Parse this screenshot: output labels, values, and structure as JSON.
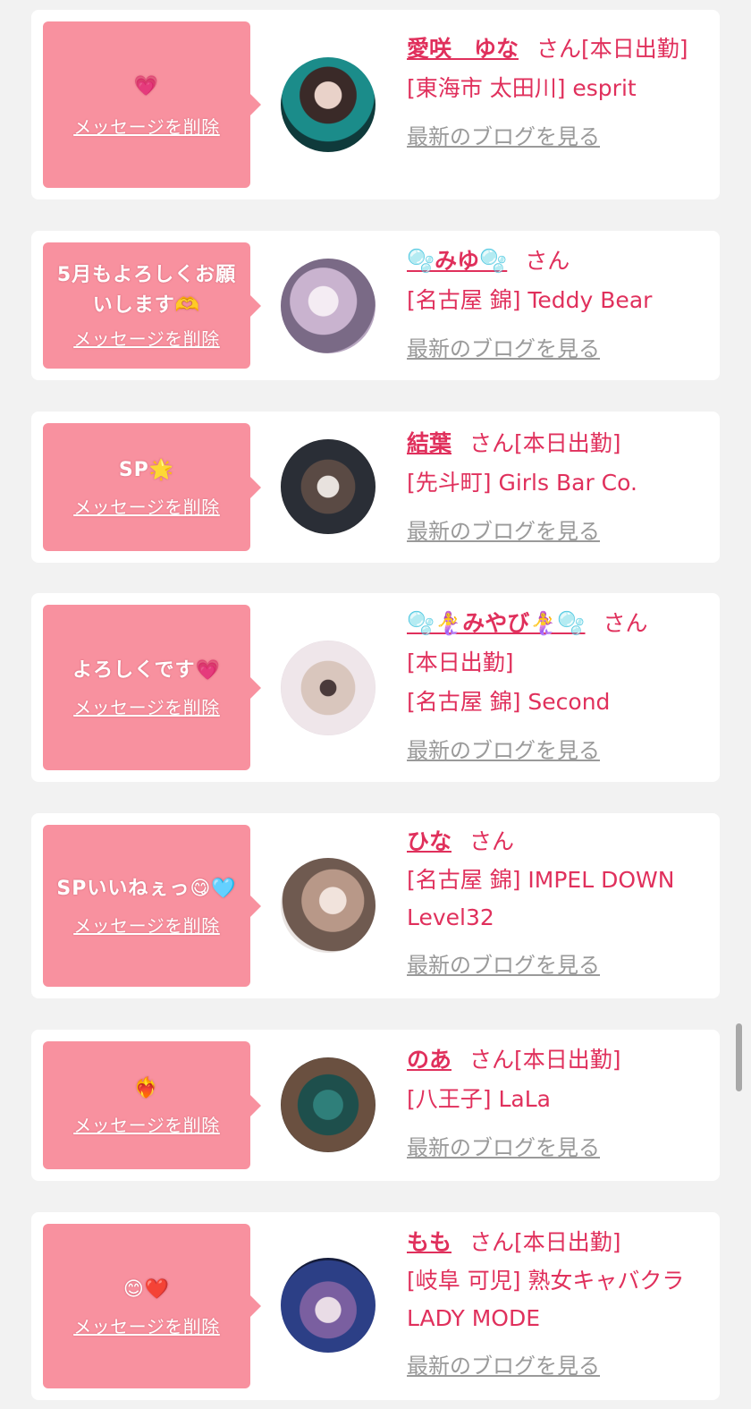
{
  "accent_color": "#e0305c",
  "bubble_color": "#f8919f",
  "link_gray": "#9a9a9a",
  "cards": [
    {
      "message": "💗",
      "delete_label": "メッセージを削除",
      "name": "愛咲　ゆな",
      "san": "さん",
      "status": "[本日出勤]",
      "shop": "[東海市 太田川] esprit",
      "blog_label": "最新のブログを見る"
    },
    {
      "message": "5月もよろしくお願いします🫶",
      "delete_label": "メッセージを削除",
      "name": "🫧みゆ🫧",
      "san": "さん",
      "status": "",
      "shop": "[名古屋 錦] Teddy Bear",
      "blog_label": "最新のブログを見る"
    },
    {
      "message": "SP🌟",
      "delete_label": "メッセージを削除",
      "name": "結葉",
      "san": "さん",
      "status": "[本日出勤]",
      "shop": "[先斗町] Girls Bar Co.",
      "blog_label": "最新のブログを見る"
    },
    {
      "message": "よろしくです💗",
      "delete_label": "メッセージを削除",
      "name": "🫧🧜‍♀️みやび🧜‍♀️🫧",
      "san": "さん",
      "status": "[本日出勤]",
      "shop": "[名古屋 錦] Second",
      "blog_label": "最新のブログを見る"
    },
    {
      "message": "SPいいねぇっ😋🩵",
      "delete_label": "メッセージを削除",
      "name": "ひな",
      "san": "さん",
      "status": "",
      "shop": "[名古屋 錦] IMPEL DOWN Level32",
      "blog_label": "最新のブログを見る"
    },
    {
      "message": "❤️‍🔥",
      "delete_label": "メッセージを削除",
      "name": "のあ",
      "san": "さん",
      "status": "[本日出勤]",
      "shop": "[八王子] LaLa",
      "blog_label": "最新のブログを見る"
    },
    {
      "message": "😊❤️",
      "delete_label": "メッセージを削除",
      "name": "もも",
      "san": "さん",
      "status": "[本日出勤]",
      "shop": "[岐阜 可児] 熟女キャバクラ LADY MODE",
      "blog_label": "最新のブログを見る"
    }
  ]
}
